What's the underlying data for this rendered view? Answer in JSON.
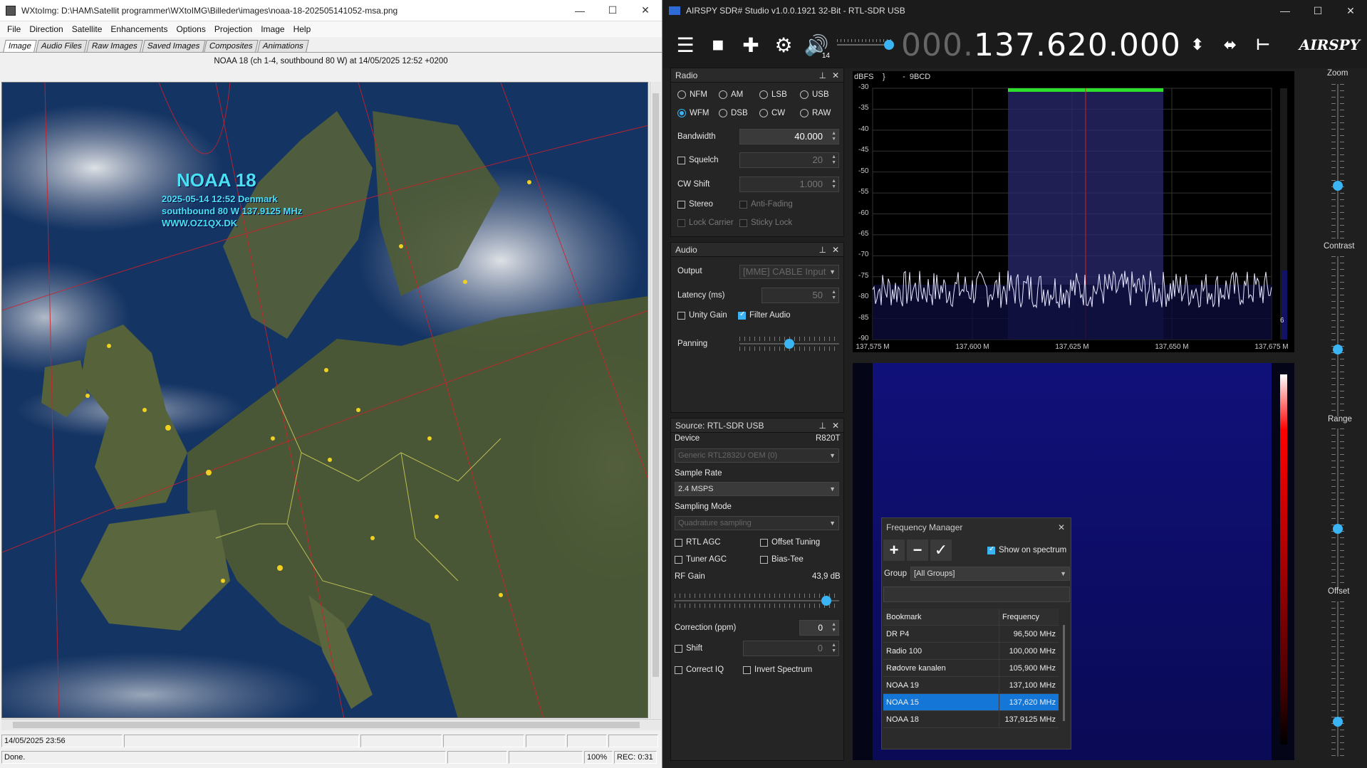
{
  "wx": {
    "title": "WXtoImg: D:\\HAM\\Satellit programmer\\WXtoIMG\\Billeder\\images\\noaa-18-202505141052-msa.png",
    "menu": [
      "File",
      "Direction",
      "Satellite",
      "Enhancements",
      "Options",
      "Projection",
      "Image",
      "Help"
    ],
    "tabs": [
      "Image",
      "Audio Files",
      "Raw Images",
      "Saved Images",
      "Composites",
      "Animations"
    ],
    "caption": "NOAA 18 (ch 1-4, southbound 80 W) at 14/05/2025  12:52 +0200",
    "overlay": {
      "title": "NOAA 18",
      "line1": "2025-05-14  12:52 Denmark",
      "line2": "southbound 80 W  137.9125 MHz",
      "line3": "WWW.OZ1QX.DK"
    },
    "status_date": "14/05/2025  23:56",
    "status_text": "Done.",
    "zoom": "100%",
    "rec": "REC: 0:31"
  },
  "sdr": {
    "title": "AIRSPY SDR# Studio v1.0.0.1921 32-Bit - RTL-SDR USB",
    "volume_value": "14",
    "freq_dim": "000.",
    "freq_main": "137.620.000",
    "logo": "AIRSPY",
    "radio": {
      "header": "Radio",
      "modes_row1": [
        "NFM",
        "AM",
        "LSB",
        "USB"
      ],
      "modes_row2": [
        "WFM",
        "DSB",
        "CW",
        "RAW"
      ],
      "selected_mode": "WFM",
      "bandwidth_label": "Bandwidth",
      "bandwidth_value": "40.000",
      "squelch_label": "Squelch",
      "squelch_value": "20",
      "cwshift_label": "CW Shift",
      "cwshift_value": "1.000",
      "stereo_label": "Stereo",
      "antifading_label": "Anti-Fading",
      "lockcarrier_label": "Lock Carrier",
      "stickylock_label": "Sticky Lock"
    },
    "audio": {
      "header": "Audio",
      "output_label": "Output",
      "output_value": "[MME] CABLE Input",
      "latency_label": "Latency (ms)",
      "latency_value": "50",
      "unitygain_label": "Unity Gain",
      "filteraudio_label": "Filter Audio",
      "panning_label": "Panning",
      "panning_level": 0.5
    },
    "source": {
      "header": "Source: RTL-SDR USB",
      "device_label": "Device",
      "device_tuner": "R820T",
      "device_value": "Generic RTL2832U OEM (0)",
      "samplerate_label": "Sample Rate",
      "samplerate_value": "2.4 MSPS",
      "samplingmode_label": "Sampling Mode",
      "samplingmode_value": "Quadrature sampling",
      "rtlagc_label": "RTL AGC",
      "offsettuning_label": "Offset Tuning",
      "tuneragc_label": "Tuner AGC",
      "biastee_label": "Bias-Tee",
      "rfgain_label": "RF Gain",
      "rfgain_value": "43,9 dB",
      "rfgain_level": 0.95,
      "correction_label": "Correction (ppm)",
      "correction_value": "0",
      "shift_label": "Shift",
      "shift_value": "0",
      "correctiq_label": "Correct IQ",
      "invertspectrum_label": "Invert Spectrum"
    },
    "spectrum": {
      "dbfs_label": "dBFS",
      "marker_text": "}        -  9BCD",
      "y_ticks": [
        "-30",
        "-35",
        "-40",
        "-45",
        "-50",
        "-55",
        "-60",
        "-65",
        "-70",
        "-75",
        "-80",
        "-85",
        "-90"
      ],
      "x_ticks": [
        "137,575 M",
        "137,600 M",
        "137,625 M",
        "137,650 M",
        "137,675 M"
      ],
      "side_value": "6"
    },
    "sidebar_labels": {
      "zoom": "Zoom",
      "contrast": "Contrast",
      "range": "Range",
      "offset": "Offset"
    },
    "freqmgr": {
      "title": "Frequency Manager",
      "show_on_spectrum": "Show on spectrum",
      "group_label": "Group",
      "group_value": "[All Groups]",
      "col_bookmark": "Bookmark",
      "col_frequency": "Frequency",
      "rows": [
        {
          "name": "DR P4",
          "freq": "96,500 MHz"
        },
        {
          "name": "Radio 100",
          "freq": "100,000 MHz"
        },
        {
          "name": "Rødovre kanalen",
          "freq": "105,900 MHz"
        },
        {
          "name": "NOAA 19",
          "freq": "137,100 MHz"
        },
        {
          "name": "NOAA 15",
          "freq": "137,620 MHz"
        },
        {
          "name": "NOAA 18",
          "freq": "137,9125 MHz"
        }
      ],
      "selected_row": 4
    }
  }
}
